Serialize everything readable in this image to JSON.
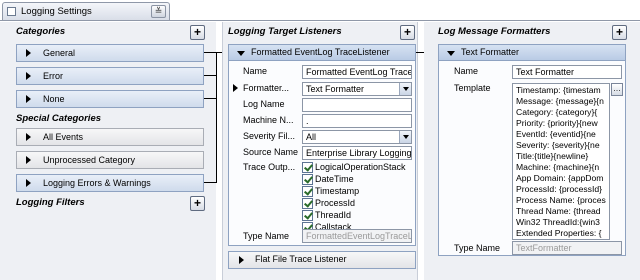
{
  "window": {
    "title": "Logging Settings"
  },
  "left": {
    "categories_header": "Categories",
    "categories": [
      "General",
      "Error",
      "None"
    ],
    "special_header": "Special Categories",
    "special": [
      "All Events",
      "Unprocessed Category",
      "Logging Errors & Warnings"
    ],
    "filters_header": "Logging Filters"
  },
  "mid": {
    "header": "Logging Target Listeners",
    "listener": {
      "title": "Formatted EventLog TraceListener",
      "labels": {
        "name": "Name",
        "formatter": "Formatter...",
        "log_name": "Log Name",
        "machine_name": "Machine N...",
        "severity": "Severity Fil...",
        "source_name": "Source Name",
        "trace_output": "Trace Outp...",
        "type_name": "Type Name"
      },
      "values": {
        "name": "Formatted EventLog Trace",
        "formatter": "Text Formatter",
        "log_name": "",
        "machine_name": ".",
        "severity": "All",
        "source_name": "Enterprise Library Logging",
        "type_name": "FormattedEventLogTraceL"
      },
      "trace_options": [
        "LogicalOperationStack",
        "DateTime",
        "Timestamp",
        "ProcessId",
        "ThreadId",
        "Callstack"
      ]
    },
    "flat_file": "Flat File Trace Listener"
  },
  "right": {
    "header": "Log Message Formatters",
    "formatter": {
      "title": "Text Formatter",
      "labels": {
        "name": "Name",
        "template": "Template",
        "type_name": "Type Name"
      },
      "values": {
        "name": "Text Formatter",
        "type_name": "TextFormatter"
      },
      "template_lines": [
        "Timestamp: {timestam",
        "Message: {message}{n",
        "Category: {category}{",
        "Priority: {priority}{new",
        "EventId: {eventid}{ne",
        "Severity: {severity}{ne",
        "Title:{title}{newline}",
        "Machine: {machine}{n",
        "App Domain: {appDom",
        "ProcessId: {processId}",
        "Process Name: {proces",
        "Thread Name: {thread",
        "Win32 ThreadId:{win3",
        "Extended Properties: {"
      ]
    }
  },
  "colors": {
    "node_fill": "#cfdbec",
    "node_border": "#8ea2c1",
    "panel_header": "#b9cbe5",
    "background": "#eef0f4"
  }
}
